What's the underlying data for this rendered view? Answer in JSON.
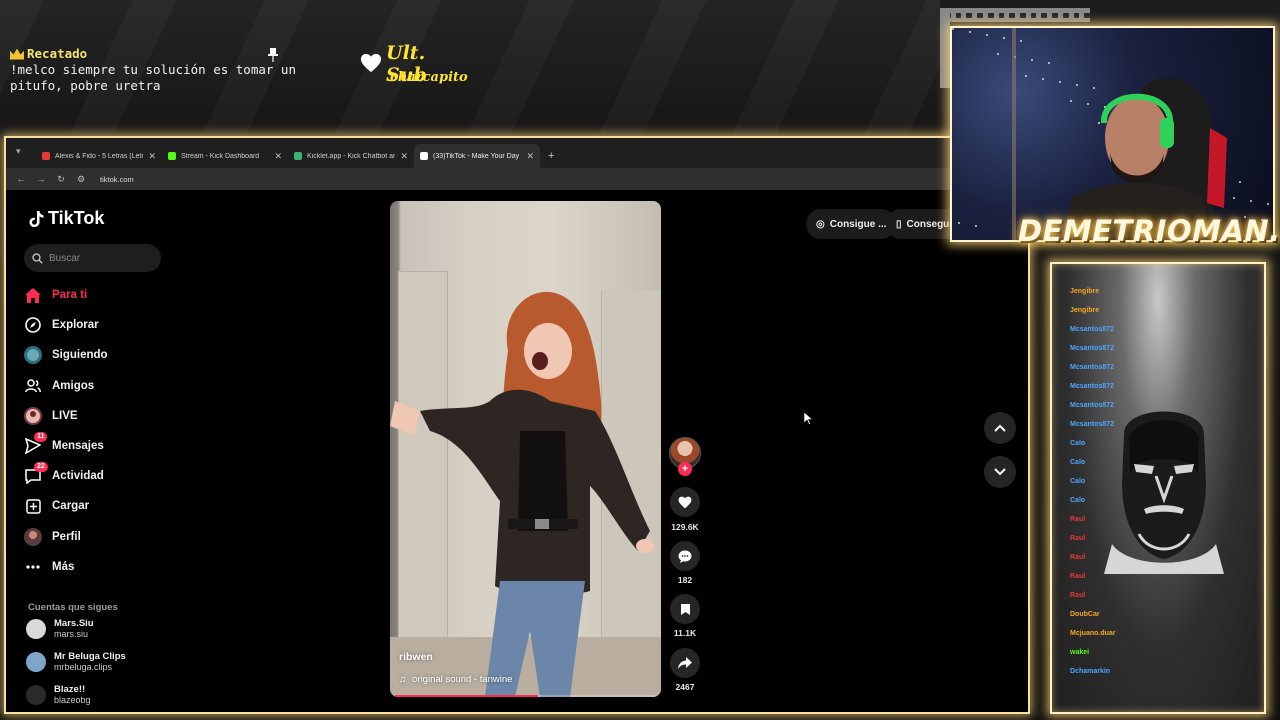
{
  "overlay": {
    "chat_user": "Recatado",
    "chat_message": "!melco siempre tu solución es tomar un pitufo, pobre uretra",
    "ult_sub_title": "Ult. Sub",
    "ult_sub_name": "charcapito"
  },
  "browser": {
    "tabs": [
      {
        "title": "Alexis & Fido - 5 Letras (Letra)",
        "color": "#e53935",
        "active": false
      },
      {
        "title": "Stream - Kick Dashboard",
        "color": "#53fc18",
        "active": false
      },
      {
        "title": "Kicklet.app - Kick Chatbot and",
        "color": "#3cb371",
        "active": false
      },
      {
        "title": "(33)TikTok - Make Your Day",
        "color": "#ffffff",
        "active": true
      }
    ],
    "url": "tiktok.com"
  },
  "tiktok": {
    "logo": "TikTok",
    "search_placeholder": "Buscar",
    "nav": [
      {
        "label": "Para ti",
        "icon": "home-icon",
        "badge": ""
      },
      {
        "label": "Explorar",
        "icon": "compass-icon",
        "badge": ""
      },
      {
        "label": "Siguiendo",
        "icon": "following-avatar-icon",
        "badge": ""
      },
      {
        "label": "Amigos",
        "icon": "friends-icon",
        "badge": ""
      },
      {
        "label": "LIVE",
        "icon": "live-avatar-icon",
        "badge": ""
      },
      {
        "label": "Mensajes",
        "icon": "messages-icon",
        "badge": "11"
      },
      {
        "label": "Actividad",
        "icon": "activity-icon",
        "badge": "22"
      },
      {
        "label": "Cargar",
        "icon": "upload-icon",
        "badge": ""
      },
      {
        "label": "Perfil",
        "icon": "profile-avatar-icon",
        "badge": ""
      },
      {
        "label": "Más",
        "icon": "more-icon",
        "badge": ""
      }
    ],
    "following_heading": "Cuentas que sigues",
    "following": [
      {
        "name": "Mars.Siu",
        "handle": "mars.siu"
      },
      {
        "name": "Mr Beluga Clips",
        "handle": "mrbeluga.clips"
      },
      {
        "name": "Blaze!!",
        "handle": "blazeobg"
      }
    ],
    "video": {
      "username": "ribwen",
      "sound": "original sound - tanwine",
      "progress": 0.55
    },
    "actions": {
      "likes": "129.6K",
      "comments": "182",
      "saves": "11.1K",
      "shares": "2467"
    },
    "cta": [
      "Consigue ...",
      "Consegui"
    ]
  },
  "webcam": {
    "streamer_name": "DEMETRIOMAN...."
  },
  "chat_panel": {
    "lines": [
      {
        "user": "Jengibre",
        "color": "#f5a623"
      },
      {
        "user": "Jengibre",
        "color": "#f5a623"
      },
      {
        "user": "Mcsantos872",
        "color": "#4da6ff"
      },
      {
        "user": "Mcsantos872",
        "color": "#4da6ff"
      },
      {
        "user": "Mcsantos872",
        "color": "#4da6ff"
      },
      {
        "user": "Mcsantos872",
        "color": "#4da6ff"
      },
      {
        "user": "Mcsantos872",
        "color": "#4da6ff"
      },
      {
        "user": "Mcsantos872",
        "color": "#4da6ff"
      },
      {
        "user": "Calo",
        "color": "#4da6ff"
      },
      {
        "user": "Calo",
        "color": "#4da6ff"
      },
      {
        "user": "Calo",
        "color": "#4da6ff"
      },
      {
        "user": "Calo",
        "color": "#4da6ff"
      },
      {
        "user": "Raul",
        "color": "#e53935"
      },
      {
        "user": "Raul",
        "color": "#e53935"
      },
      {
        "user": "Raul",
        "color": "#e53935"
      },
      {
        "user": "Raul",
        "color": "#e53935"
      },
      {
        "user": "Raul",
        "color": "#e53935"
      },
      {
        "user": "DoubCar",
        "color": "#f5a623"
      },
      {
        "user": "Mcjuano.duar",
        "color": "#f5a623"
      },
      {
        "user": "wakei",
        "color": "#53fc18"
      },
      {
        "user": "Dchamarkin",
        "color": "#4da6ff"
      }
    ]
  }
}
